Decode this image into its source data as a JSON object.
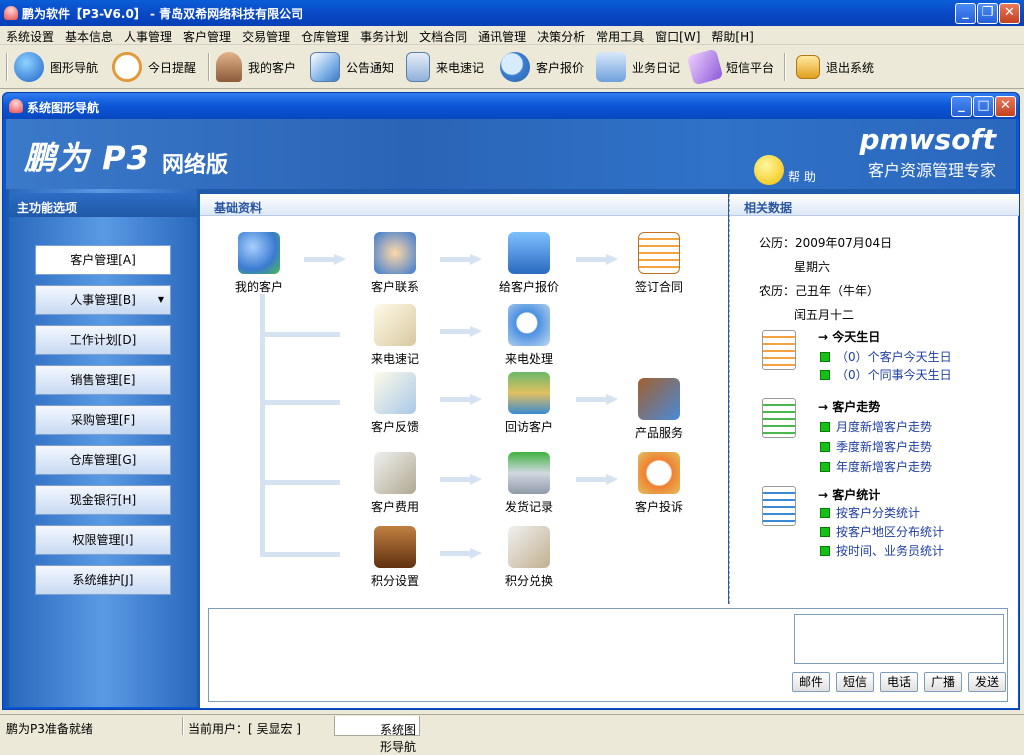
{
  "app": {
    "title": "鹏为软件【P3-V6.0】 - 青岛双希网络科技有限公司"
  },
  "menu": [
    "系统设置",
    "基本信息",
    "人事管理",
    "客户管理",
    "交易管理",
    "仓库管理",
    "事务计划",
    "文档合同",
    "通讯管理",
    "决策分析",
    "常用工具",
    "窗口[W]",
    "帮助[H]"
  ],
  "toolbar": [
    {
      "label": "图形导航",
      "icon": "globe-icon"
    },
    {
      "label": "今日提醒",
      "icon": "clock-icon"
    },
    {
      "label": "我的客户",
      "icon": "people-icon"
    },
    {
      "label": "公告通知",
      "icon": "notice-icon"
    },
    {
      "label": "来电速记",
      "icon": "phone-icon"
    },
    {
      "label": "客户报价",
      "icon": "quote-icon"
    },
    {
      "label": "业务日记",
      "icon": "folder-icon"
    },
    {
      "label": "短信平台",
      "icon": "sms-icon"
    },
    {
      "label": "退出系统",
      "icon": "exit-icon"
    }
  ],
  "window": {
    "title": "系统图形导航"
  },
  "banner": {
    "logo": "鹏为 P3",
    "edition": "网络版",
    "brand": "pmwsoft",
    "slogan": "客户资源管理专家",
    "help": "帮 助"
  },
  "sidebar": {
    "header": "主功能选项",
    "items": [
      "客户管理[A]",
      "人事管理[B]",
      "工作计划[D]",
      "销售管理[E]",
      "采购管理[F]",
      "仓库管理[G]",
      "现金银行[H]",
      "权限管理[I]",
      "系统维护[J]"
    ]
  },
  "basic": {
    "header": "基础资料",
    "nodes": {
      "my_customer": "我的客户",
      "contact": "客户联系",
      "quote": "给客户报价",
      "contract": "签订合同",
      "call_note": "来电速记",
      "call_handle": "来电处理",
      "feedback": "客户反馈",
      "revisit": "回访客户",
      "product": "产品服务",
      "cost": "客户费用",
      "shipping": "发货记录",
      "complaint": "客户投诉",
      "points_set": "积分设置",
      "points_redeem": "积分兑换"
    }
  },
  "related": {
    "header": "相关数据",
    "solar": "公历：2009年07月04日",
    "weekday": "星期六",
    "lunar": "农历：己丑年（牛年）",
    "lunar_day": "闰五月十二",
    "birthday": {
      "title": "→ 今天生日",
      "items": [
        "（0）个客户今天生日",
        "（0）个同事今天生日"
      ]
    },
    "trend": {
      "title": "→ 客户走势",
      "items": [
        "月度新增客户走势",
        "季度新增客户走势",
        "年度新增客户走势"
      ]
    },
    "stats": {
      "title": "→ 客户统计",
      "items": [
        "按客户分类统计",
        "按客户地区分布统计",
        "按时间、业务员统计"
      ]
    }
  },
  "actions": [
    "邮件",
    "短信",
    "电话",
    "广播",
    "发送"
  ],
  "status": {
    "ready": "鹏为P3准备就绪",
    "user": "当前用户：[ 吴显宏 ]",
    "tab": "系统图形导航"
  }
}
